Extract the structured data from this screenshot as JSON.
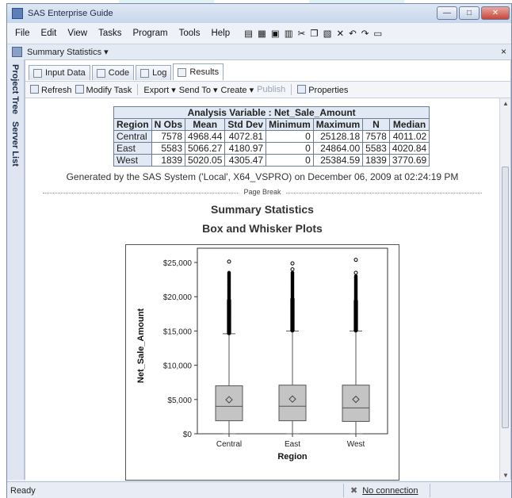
{
  "window": {
    "title": "SAS Enterprise Guide",
    "minimize": "—",
    "maximize": "□",
    "close": "✕"
  },
  "menu": [
    "File",
    "Edit",
    "View",
    "Tasks",
    "Program",
    "Tools",
    "Help"
  ],
  "doc_tab": {
    "label": "Summary Statistics ▾",
    "close": "×"
  },
  "sidebar": {
    "project_tree": "Project Tree",
    "server_list": "Server List"
  },
  "result_tabs": [
    "Input Data",
    "Code",
    "Log",
    "Results"
  ],
  "toolbar": {
    "refresh": "Refresh",
    "modify": "Modify Task",
    "export": "Export ▾",
    "send_to": "Send To ▾",
    "create": "Create ▾",
    "publish": "Publish",
    "properties": "Properties"
  },
  "table": {
    "title": "Analysis Variable : Net_Sale_Amount",
    "headers": [
      "Region",
      "N Obs",
      "Mean",
      "Std Dev",
      "Minimum",
      "Maximum",
      "N",
      "Median"
    ],
    "rows": [
      [
        "Central",
        "7578",
        "4968.44",
        "4072.81",
        "0",
        "25128.18",
        "7578",
        "4011.02"
      ],
      [
        "East",
        "5583",
        "5066.27",
        "4180.97",
        "0",
        "24864.00",
        "5583",
        "4020.84"
      ],
      [
        "West",
        "1839",
        "5020.05",
        "4305.47",
        "0",
        "25384.59",
        "1839",
        "3770.69"
      ]
    ]
  },
  "generated": "Generated by the SAS System ('Local', X64_VSPRO) on December 06, 2009 at 02:24:19 PM",
  "page_break": "Page Break",
  "heading1": "Summary Statistics",
  "heading2": "Box and Whisker Plots",
  "status": {
    "ready": "Ready",
    "connection": "No connection"
  },
  "chart_data": {
    "type": "box",
    "xlabel": "Region",
    "ylabel": "Net_Sale_Amount",
    "ylim": [
      0,
      25000
    ],
    "yticks": [
      "$0",
      "$5,000",
      "$10,000",
      "$15,000",
      "$20,000",
      "$25,000"
    ],
    "ytick_values": [
      0,
      5000,
      10000,
      15000,
      20000,
      25000
    ],
    "categories": [
      "Central",
      "East",
      "West"
    ],
    "boxes": [
      {
        "name": "Central",
        "min": 0,
        "q1": 1900,
        "median": 4011,
        "q3": 7000,
        "whisker_hi": 14600,
        "mean": 4968,
        "outliers_from": 14700,
        "outliers_to": 23500,
        "far_outliers": [
          25128
        ]
      },
      {
        "name": "East",
        "min": 0,
        "q1": 1900,
        "median": 4021,
        "q3": 7100,
        "whisker_hi": 15000,
        "mean": 5066,
        "outliers_from": 15100,
        "outliers_to": 23500,
        "far_outliers": [
          24000,
          24864
        ]
      },
      {
        "name": "West",
        "min": 0,
        "q1": 1800,
        "median": 3771,
        "q3": 7100,
        "whisker_hi": 15000,
        "mean": 5020,
        "outliers_from": 15100,
        "outliers_to": 23000,
        "far_outliers": [
          23500,
          25385
        ]
      }
    ],
    "colors": {
      "box_fill": "#c4c4c4",
      "box_stroke": "#555555"
    }
  }
}
